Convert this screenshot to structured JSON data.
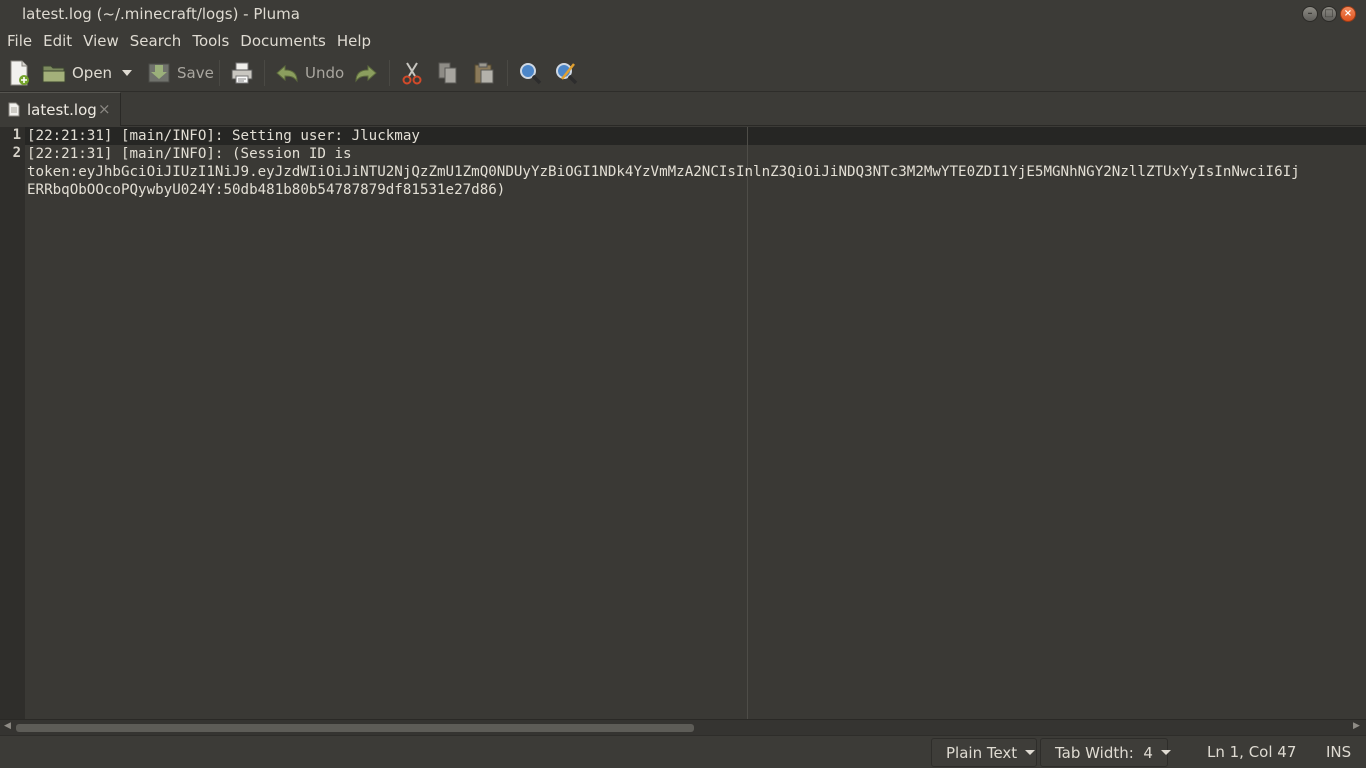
{
  "window": {
    "title": "latest.log (~/.minecraft/logs) - Pluma",
    "minimize_glyph": "–",
    "maximize_glyph": "□",
    "close_glyph": "×"
  },
  "menu": [
    "File",
    "Edit",
    "View",
    "Search",
    "Tools",
    "Documents",
    "Help"
  ],
  "toolbar": {
    "new_icon": "new-document-icon",
    "open_label": "Open",
    "save_label": "Save",
    "print_icon": "print-icon",
    "undo_label": "Undo",
    "redo_icon": "redo-icon",
    "cut_icon": "cut-icon",
    "copy_icon": "copy-icon",
    "paste_icon": "paste-icon",
    "find_icon": "find-icon",
    "replace_icon": "find-replace-icon"
  },
  "tabs": [
    {
      "label": "latest.log",
      "close": "×"
    }
  ],
  "editor": {
    "line_numbers": [
      "1",
      "2"
    ],
    "lines": [
      "[22:21:31] [main/INFO]: Setting user: Jluckmay",
      "[22:21:31] [main/INFO]: (Session ID is",
      "token:eyJhbGciOiJIUzI1NiJ9.eyJzdWIiOiJiNTU2NjQzZmU1ZmQ0NDUyYzBiOGI1NDk4YzVmMzA2NCIsInlnZ3QiOiJiNDQ3NTc3M2MwYTE0ZDI1YjE5MGNhNGY2NzllZTUxYyIsInNwciI6Ij",
      "ERRbqObOOcoPQywbyU024Y:50db481b80b54787879df81531e27d86)"
    ]
  },
  "statusbar": {
    "language": "Plain Text",
    "tab_width": "Tab Width:  4",
    "position": "Ln 1, Col 47",
    "mode": "INS"
  },
  "colors": {
    "background": "#3c3b37",
    "editor_bg": "#3a3935",
    "current_line": "#262624",
    "close_button": "#e0531f"
  }
}
